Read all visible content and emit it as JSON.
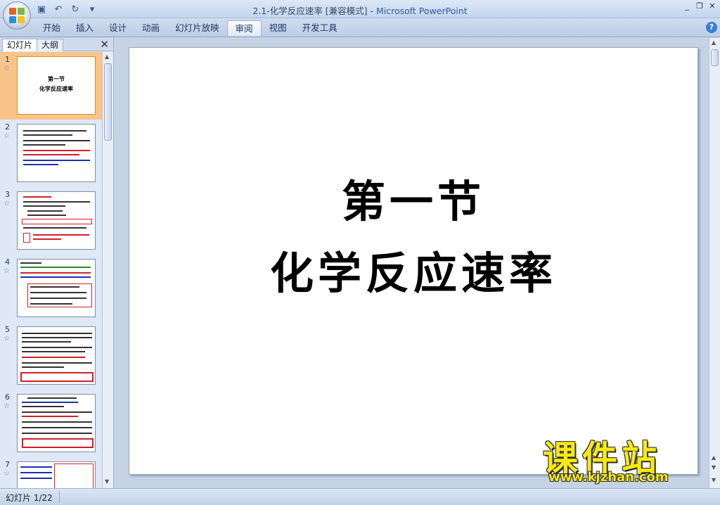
{
  "window": {
    "title_doc": "2.1-化学反应速率 [兼容模式]",
    "title_sep": " - ",
    "title_app": "Microsoft PowerPoint",
    "controls": [
      "_",
      "❐",
      "✕"
    ]
  },
  "quick_access": {
    "save_icon": "▣",
    "undo_icon": "↶",
    "redo_icon": "↻",
    "customize_icon": "▾"
  },
  "ribbon": {
    "tabs": [
      {
        "label": "开始"
      },
      {
        "label": "插入"
      },
      {
        "label": "设计"
      },
      {
        "label": "动画"
      },
      {
        "label": "幻灯片放映"
      },
      {
        "label": "审阅",
        "active": true
      },
      {
        "label": "视图"
      },
      {
        "label": "开发工具"
      }
    ],
    "help_label": "?"
  },
  "left_pane": {
    "tab_slides": "幻灯片",
    "tab_outline": "大纲",
    "close_label": "✕",
    "thumbnails": [
      {
        "num": "1",
        "selected": true,
        "title": "第一节",
        "subtitle": "化学反应速率"
      },
      {
        "num": "2"
      },
      {
        "num": "3"
      },
      {
        "num": "4"
      },
      {
        "num": "5"
      },
      {
        "num": "6"
      },
      {
        "num": "7"
      }
    ],
    "star": "☆"
  },
  "slide": {
    "heading": "第一节",
    "subheading": "化学反应速率"
  },
  "watermark": {
    "big": "课件站",
    "url": "www.kjzhan.com"
  },
  "statusbar": {
    "slide_info": "幻灯片 1/22"
  },
  "colors": {
    "accent": "#2f5aa8",
    "selected_thumb": "#f9c48a",
    "watermark": "#f6ea12"
  }
}
